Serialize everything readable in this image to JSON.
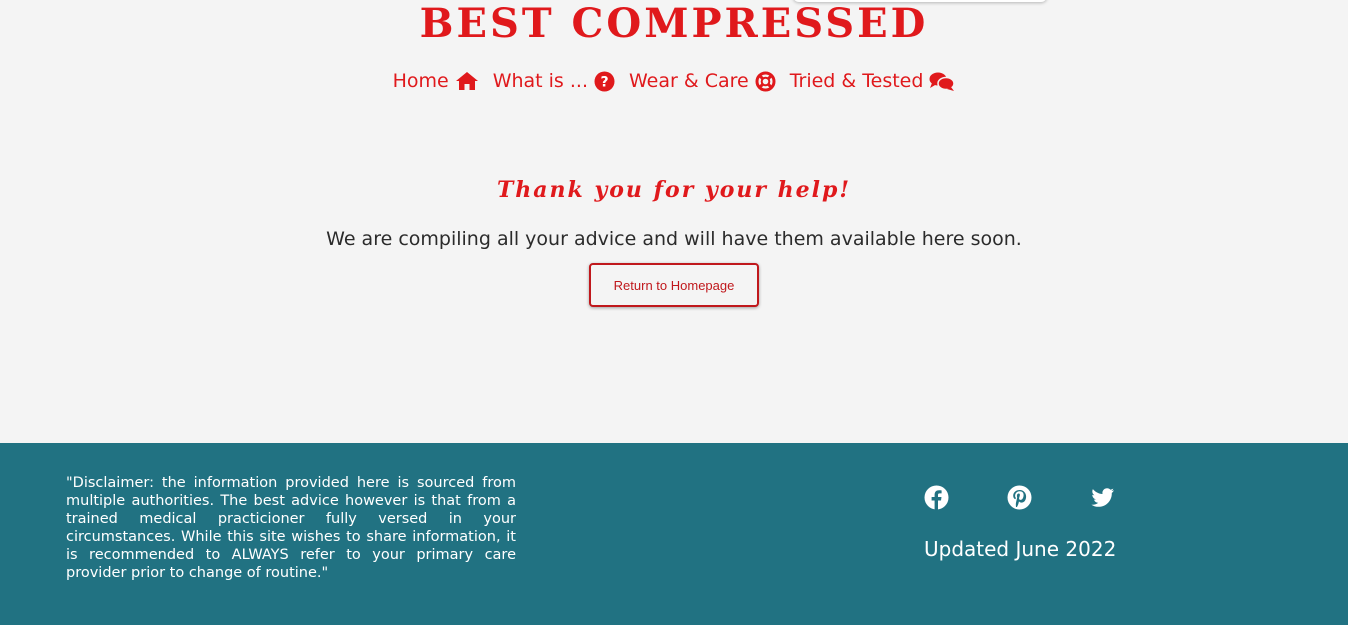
{
  "header": {
    "site_title": "BEST COMPRESSED"
  },
  "nav": {
    "items": [
      {
        "label": "Home",
        "icon": "home-icon"
      },
      {
        "label": "What is ...",
        "icon": "question-circle-icon"
      },
      {
        "label": "Wear & Care",
        "icon": "life-ring-icon"
      },
      {
        "label": "Tried & Tested",
        "icon": "comments-icon"
      }
    ]
  },
  "main": {
    "heading": "Thank you for your help!",
    "message": "We are compiling all your advice and will have them available here soon.",
    "button_label": "Return to Homepage"
  },
  "footer": {
    "disclaimer": "\"Disclaimer: the information provided here is sourced from multiple authorities. The best advice however is that from a trained medical practicioner fully versed in your circumstances. While this site wishes to share information, it is recommended to ALWAYS refer to your primary care provider prior to change of routine.\"",
    "social": [
      {
        "icon": "facebook-icon"
      },
      {
        "icon": "pinterest-icon"
      },
      {
        "icon": "twitter-icon"
      }
    ],
    "updated": "Updated June 2022"
  },
  "colors": {
    "accent": "#e0191c",
    "footer_bg": "#217282",
    "page_bg": "#f4f4f4"
  }
}
